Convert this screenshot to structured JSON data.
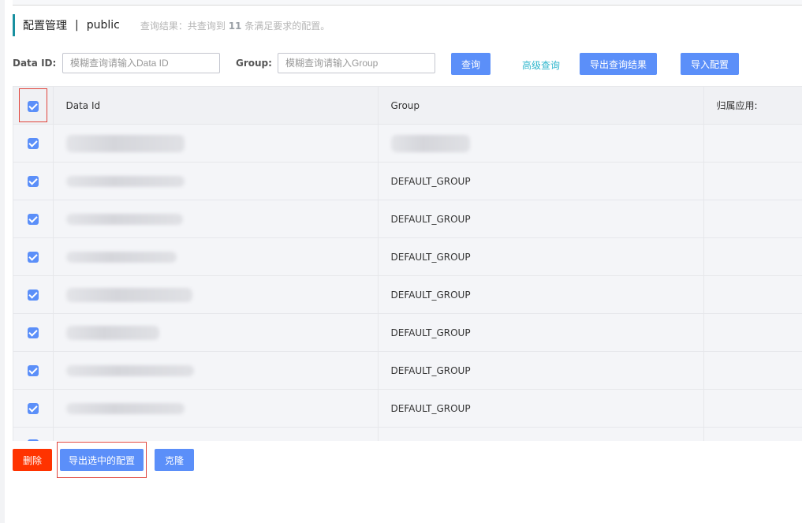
{
  "title": {
    "main": "配置管理",
    "separator": "|",
    "namespace": "public",
    "result_prefix": "查询结果：共查询到",
    "result_count": "11",
    "result_suffix": "条满足要求的配置。"
  },
  "search": {
    "data_id_label": "Data ID:",
    "data_id_placeholder": "模糊查询请输入Data ID",
    "group_label": "Group:",
    "group_placeholder": "模糊查询请输入Group",
    "query_button": "查询",
    "advanced_link": "高级查询",
    "export_result_button": "导出查询结果",
    "import_button": "导入配置"
  },
  "table": {
    "columns": [
      "Data Id",
      "Group",
      "归属应用:"
    ],
    "rows": [
      {
        "group": ""
      },
      {
        "group": "DEFAULT_GROUP"
      },
      {
        "group": "DEFAULT_GROUP"
      },
      {
        "group": "DEFAULT_GROUP"
      },
      {
        "group": "DEFAULT_GROUP"
      },
      {
        "group": "DEFAULT_GROUP"
      },
      {
        "group": "DEFAULT_GROUP"
      },
      {
        "group": "DEFAULT_GROUP"
      },
      {
        "group": ""
      }
    ]
  },
  "footer": {
    "delete_button": "删除",
    "export_selected_button": "导出选中的配置",
    "clone_button": "克隆"
  },
  "colors": {
    "primary": "#5b8ff9",
    "danger": "#ff3300",
    "accent_bar": "#1890a0",
    "link": "#2eb6cc",
    "highlight_border": "#e0433b"
  },
  "icons": {
    "checkbox": "checkbox-checked-icon"
  }
}
